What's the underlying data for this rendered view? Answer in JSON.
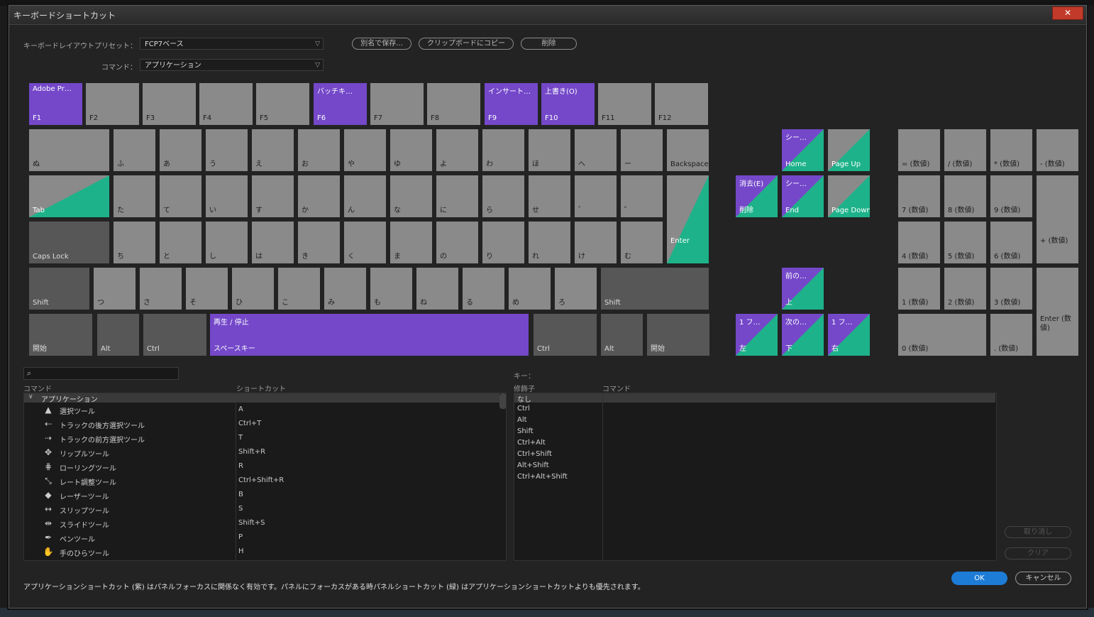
{
  "colors": {
    "app_shortcut": "#7448c9",
    "panel_shortcut": "#1db28a",
    "key": "#8a8a8a",
    "key_dark": "#575757",
    "ok": "#1d7cd6"
  },
  "title": "キーボードショートカット",
  "close_icon": "close-icon",
  "preset": {
    "label": "キーボードレイアウトプリセット：",
    "value": "FCP7ベース"
  },
  "command": {
    "label": "コマンド：",
    "value": "アプリケーション"
  },
  "buttons": {
    "save_as": "別名で保存...",
    "copy": "クリップボードにコピー",
    "delete": "削除",
    "undo": "取り消し",
    "clear": "クリア",
    "ok": "OK",
    "cancel": "キャンセル"
  },
  "keyboard": {
    "fn": [
      {
        "key": "F1",
        "cmd": "Adobe Pr…",
        "type": "purple"
      },
      {
        "key": "F2",
        "cmd": "",
        "type": "gray"
      },
      {
        "key": "F3",
        "cmd": "",
        "type": "gray"
      },
      {
        "key": "F4",
        "cmd": "",
        "type": "gray"
      },
      {
        "key": "F5",
        "cmd": "",
        "type": "gray"
      },
      {
        "key": "F6",
        "cmd": "バッチキ…",
        "type": "purple"
      },
      {
        "key": "F7",
        "cmd": "",
        "type": "gray"
      },
      {
        "key": "F8",
        "cmd": "",
        "type": "gray"
      },
      {
        "key": "F9",
        "cmd": "インサート…",
        "type": "purple"
      },
      {
        "key": "F10",
        "cmd": "上書き(O)",
        "type": "purple"
      },
      {
        "key": "F11",
        "cmd": "",
        "type": "gray"
      },
      {
        "key": "F12",
        "cmd": "",
        "type": "gray"
      }
    ],
    "row1": [
      {
        "key": "ぬ",
        "type": "gray"
      },
      {
        "key": "ふ",
        "type": "gray"
      },
      {
        "key": "あ",
        "type": "gray"
      },
      {
        "key": "う",
        "type": "gray"
      },
      {
        "key": "え",
        "type": "gray"
      },
      {
        "key": "お",
        "type": "gray"
      },
      {
        "key": "や",
        "type": "gray"
      },
      {
        "key": "ゆ",
        "type": "gray"
      },
      {
        "key": "よ",
        "type": "gray"
      },
      {
        "key": "わ",
        "type": "gray"
      },
      {
        "key": "ほ",
        "type": "gray"
      },
      {
        "key": "へ",
        "type": "gray"
      },
      {
        "key": "ー",
        "type": "gray"
      },
      {
        "key": "Backspace",
        "type": "gray"
      }
    ],
    "row2": [
      {
        "key": "Tab",
        "type": "split-gray"
      },
      {
        "key": "た",
        "type": "gray"
      },
      {
        "key": "て",
        "type": "gray"
      },
      {
        "key": "い",
        "type": "gray"
      },
      {
        "key": "す",
        "type": "gray"
      },
      {
        "key": "か",
        "type": "gray"
      },
      {
        "key": "ん",
        "type": "gray"
      },
      {
        "key": "な",
        "type": "gray"
      },
      {
        "key": "に",
        "type": "gray"
      },
      {
        "key": "ら",
        "type": "gray"
      },
      {
        "key": "せ",
        "type": "gray"
      },
      {
        "key": "゛",
        "type": "gray"
      },
      {
        "key": "゜",
        "type": "gray"
      }
    ],
    "row3": [
      {
        "key": "Caps Lock",
        "type": "dark"
      },
      {
        "key": "ち",
        "type": "gray"
      },
      {
        "key": "と",
        "type": "gray"
      },
      {
        "key": "し",
        "type": "gray"
      },
      {
        "key": "は",
        "type": "gray"
      },
      {
        "key": "き",
        "type": "gray"
      },
      {
        "key": "く",
        "type": "gray"
      },
      {
        "key": "ま",
        "type": "gray"
      },
      {
        "key": "の",
        "type": "gray"
      },
      {
        "key": "り",
        "type": "gray"
      },
      {
        "key": "れ",
        "type": "gray"
      },
      {
        "key": "け",
        "type": "gray"
      },
      {
        "key": "む",
        "type": "gray"
      }
    ],
    "enter": "Enter",
    "row4": [
      {
        "key": "Shift",
        "type": "dark"
      },
      {
        "key": "つ",
        "type": "gray"
      },
      {
        "key": "さ",
        "type": "gray"
      },
      {
        "key": "そ",
        "type": "gray"
      },
      {
        "key": "ひ",
        "type": "gray"
      },
      {
        "key": "こ",
        "type": "gray"
      },
      {
        "key": "み",
        "type": "gray"
      },
      {
        "key": "も",
        "type": "gray"
      },
      {
        "key": "ね",
        "type": "gray"
      },
      {
        "key": "る",
        "type": "gray"
      },
      {
        "key": "め",
        "type": "gray"
      },
      {
        "key": "ろ",
        "type": "gray"
      },
      {
        "key": "Shift",
        "type": "dark"
      }
    ],
    "row5": [
      {
        "key": "開始",
        "cmd": "",
        "type": "dark"
      },
      {
        "key": "Alt",
        "cmd": "",
        "type": "dark"
      },
      {
        "key": "Ctrl",
        "cmd": "",
        "type": "dark"
      },
      {
        "key": "スペースキー",
        "cmd": "再生 / 停止",
        "type": "purple"
      },
      {
        "key": "Ctrl",
        "cmd": "",
        "type": "dark"
      },
      {
        "key": "Alt",
        "cmd": "",
        "type": "dark"
      },
      {
        "key": "開始",
        "cmd": "",
        "type": "dark"
      }
    ],
    "nav": [
      {
        "key": "Home",
        "cmd": "シー…",
        "type": "split"
      },
      {
        "key": "Page Up",
        "cmd": "",
        "type": "split-gray"
      },
      {
        "key": "削除",
        "cmd": "消去(E)",
        "type": "split"
      },
      {
        "key": "End",
        "cmd": "シー…",
        "type": "split"
      },
      {
        "key": "Page Down",
        "cmd": "",
        "type": "split-gray"
      },
      {
        "key": "上",
        "cmd": "前の…",
        "type": "split"
      },
      {
        "key": "左",
        "cmd": "1 フ…",
        "type": "split"
      },
      {
        "key": "下",
        "cmd": "次の…",
        "type": "split"
      },
      {
        "key": "右",
        "cmd": "1 フ…",
        "type": "split"
      }
    ],
    "numpad": [
      {
        "key": "= (数値)"
      },
      {
        "key": "/ (数値)"
      },
      {
        "key": "* (数値)"
      },
      {
        "key": "- (数値)"
      },
      {
        "key": "7 (数値)"
      },
      {
        "key": "8 (数値)"
      },
      {
        "key": "9 (数値)"
      },
      {
        "key": "+ (数値)"
      },
      {
        "key": "4 (数値)"
      },
      {
        "key": "5 (数値)"
      },
      {
        "key": "6 (数値)"
      },
      {
        "key": "1 (数値)"
      },
      {
        "key": "2 (数値)"
      },
      {
        "key": "3 (数値)"
      },
      {
        "key": "Enter (数値)"
      },
      {
        "key": "0 (数値)"
      },
      {
        "key": ". (数値)"
      }
    ]
  },
  "search": {
    "placeholder": ""
  },
  "list": {
    "col_command": "コマンド",
    "col_shortcut": "ショートカット",
    "group": "アプリケーション",
    "items": [
      {
        "icon": "arrow-select-icon",
        "glyph": "▲",
        "name": "選択ツール",
        "shortcut": "A"
      },
      {
        "icon": "track-select-backward-icon",
        "glyph": "⇠",
        "name": "トラックの後方選択ツール",
        "shortcut": "Ctrl+T"
      },
      {
        "icon": "track-select-forward-icon",
        "glyph": "⇢",
        "name": "トラックの前方選択ツール",
        "shortcut": "T"
      },
      {
        "icon": "ripple-edit-icon",
        "glyph": "✥",
        "name": "リップルツール",
        "shortcut": "Shift+R"
      },
      {
        "icon": "rolling-edit-icon",
        "glyph": "⋕",
        "name": "ローリングツール",
        "shortcut": "R"
      },
      {
        "icon": "rate-stretch-icon",
        "glyph": "⤡",
        "name": "レート調整ツール",
        "shortcut": "Ctrl+Shift+R"
      },
      {
        "icon": "razor-icon",
        "glyph": "◆",
        "name": "レーザーツール",
        "shortcut": "B"
      },
      {
        "icon": "slip-icon",
        "glyph": "↔",
        "name": "スリップツール",
        "shortcut": "S"
      },
      {
        "icon": "slide-icon",
        "glyph": "⇹",
        "name": "スライドツール",
        "shortcut": "Shift+S"
      },
      {
        "icon": "pen-icon",
        "glyph": "✒",
        "name": "ペンツール",
        "shortcut": "P"
      },
      {
        "icon": "hand-icon",
        "glyph": "✋",
        "name": "手のひらツール",
        "shortcut": "H"
      }
    ]
  },
  "keypanel": {
    "title": "キー：",
    "col_modifier": "修飾子",
    "col_command": "コマンド",
    "modifiers": [
      "なし",
      "Ctrl",
      "Alt",
      "Shift",
      "Ctrl+Alt",
      "Ctrl+Shift",
      "Alt+Shift",
      "Ctrl+Alt+Shift"
    ]
  },
  "footer": "アプリケーションショートカット (紫) はパネルフォーカスに関係なく有効です。パネルにフォーカスがある時パネルショートカット (緑) はアプリケーションショートカットよりも優先されます。"
}
